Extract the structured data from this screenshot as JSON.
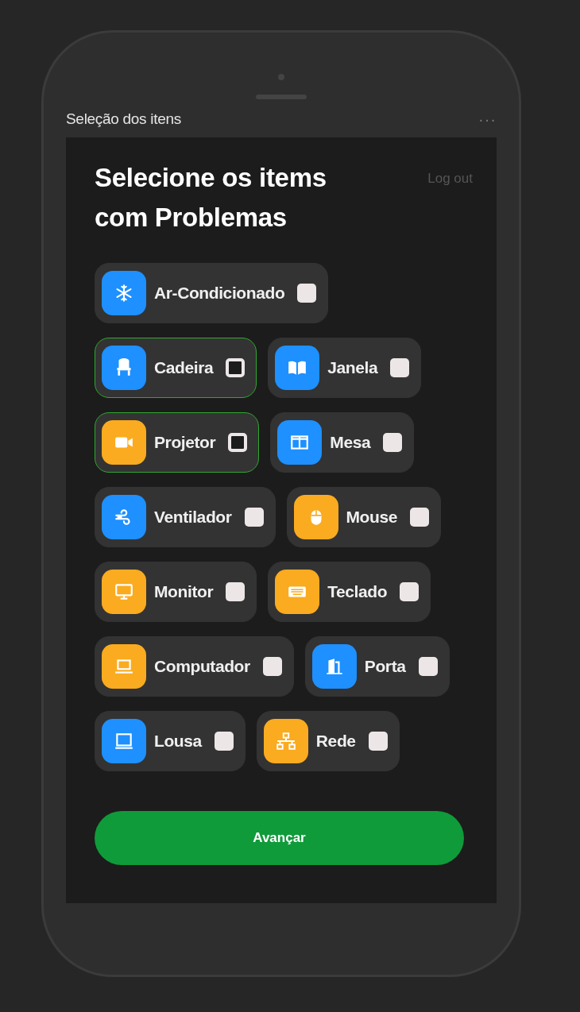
{
  "window": {
    "title": "Seleção dos itens",
    "menu": "···"
  },
  "heading": "Selecione os items com Problemas",
  "logout": "Log out",
  "rows": [
    [
      {
        "label": "Ar-Condicionado",
        "kind": "snowflake",
        "color": "#1e90ff",
        "selected": false
      }
    ],
    [
      {
        "label": "Cadeira",
        "kind": "chair",
        "color": "#1e90ff",
        "selected": true
      },
      {
        "label": "Janela",
        "kind": "book",
        "color": "#1e90ff",
        "selected": false
      }
    ],
    [
      {
        "label": "Projetor",
        "kind": "video",
        "color": "#fbab1f",
        "selected": true
      },
      {
        "label": "Mesa",
        "kind": "columns",
        "color": "#1e90ff",
        "selected": false
      }
    ],
    [
      {
        "label": "Ventilador",
        "kind": "wind",
        "color": "#1e90ff",
        "selected": false
      },
      {
        "label": "Mouse",
        "kind": "mouse",
        "color": "#fbab1f",
        "selected": false
      }
    ],
    [
      {
        "label": "Monitor",
        "kind": "monitor",
        "color": "#fbab1f",
        "selected": false
      },
      {
        "label": "Teclado",
        "kind": "keyboard",
        "color": "#fbab1f",
        "selected": false
      }
    ],
    [
      {
        "label": "Computador",
        "kind": "laptop",
        "color": "#fbab1f",
        "selected": false
      },
      {
        "label": "Porta",
        "kind": "door",
        "color": "#1e90ff",
        "selected": false
      }
    ],
    [
      {
        "label": "Lousa",
        "kind": "board",
        "color": "#1e90ff",
        "selected": false
      },
      {
        "label": "Rede",
        "kind": "network",
        "color": "#fbab1f",
        "selected": false
      }
    ]
  ],
  "button": "Avançar"
}
